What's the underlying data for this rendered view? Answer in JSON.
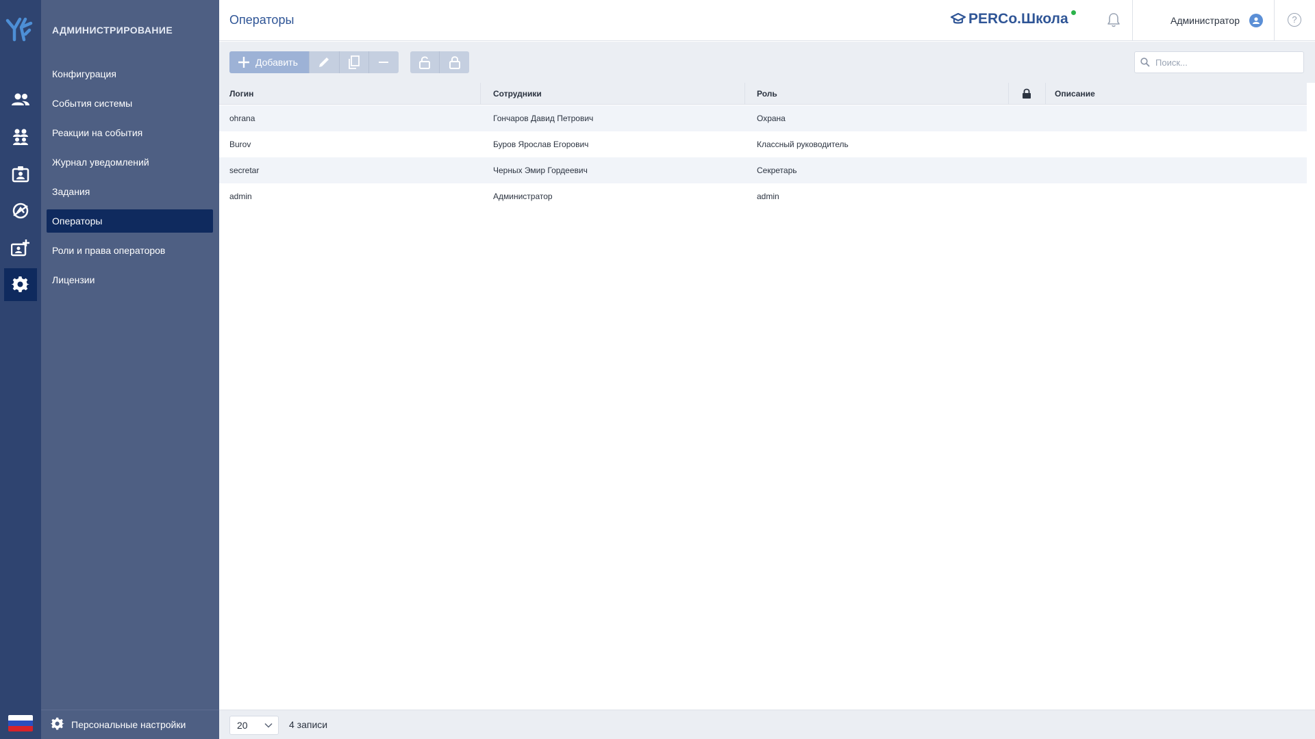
{
  "app": {
    "section_title": "АДМИНИСТРИРОВАНИЕ",
    "brand": "PERCo.Школа"
  },
  "header": {
    "page_title": "Операторы",
    "user_name": "Администратор",
    "help": "?"
  },
  "menu": {
    "items": [
      {
        "label": "Конфигурация"
      },
      {
        "label": "События системы"
      },
      {
        "label": "Реакции на события"
      },
      {
        "label": "Журнал уведомлений"
      },
      {
        "label": "Задания"
      },
      {
        "label": "Операторы",
        "active": true
      },
      {
        "label": "Роли и права операторов"
      },
      {
        "label": "Лицензии"
      }
    ],
    "footer_label": "Персональные настройки"
  },
  "rail": {
    "icons": [
      "users-icon",
      "groups-icon",
      "badge-icon",
      "access-icon",
      "add-badge-icon",
      "gear-icon"
    ],
    "active": "gear-icon"
  },
  "toolbar": {
    "add_label": "Добавить",
    "search_placeholder": "Поиск..."
  },
  "table": {
    "columns": [
      "Логин",
      "Сотрудники",
      "Роль",
      "",
      "Описание"
    ],
    "rows": [
      {
        "login": "ohrana",
        "employee": "Гончаров Давид Петрович",
        "role": "Охрана",
        "description": ""
      },
      {
        "login": "Burov",
        "employee": "Буров Ярослав Егорович",
        "role": "Классный руководитель",
        "description": ""
      },
      {
        "login": "secretar",
        "employee": "Черных Эмир Гордеевич",
        "role": "Секретарь",
        "description": ""
      },
      {
        "login": "admin",
        "employee": "Администратор",
        "role": "admin",
        "description": ""
      }
    ]
  },
  "footer": {
    "page_size": "20",
    "records_count": "4 записи"
  },
  "colors": {
    "rail": "#2f4470",
    "menu": "#4e5f83",
    "active": "#0f2a5e",
    "accent": "#2f5596",
    "status_dot": "#2bb34a"
  }
}
